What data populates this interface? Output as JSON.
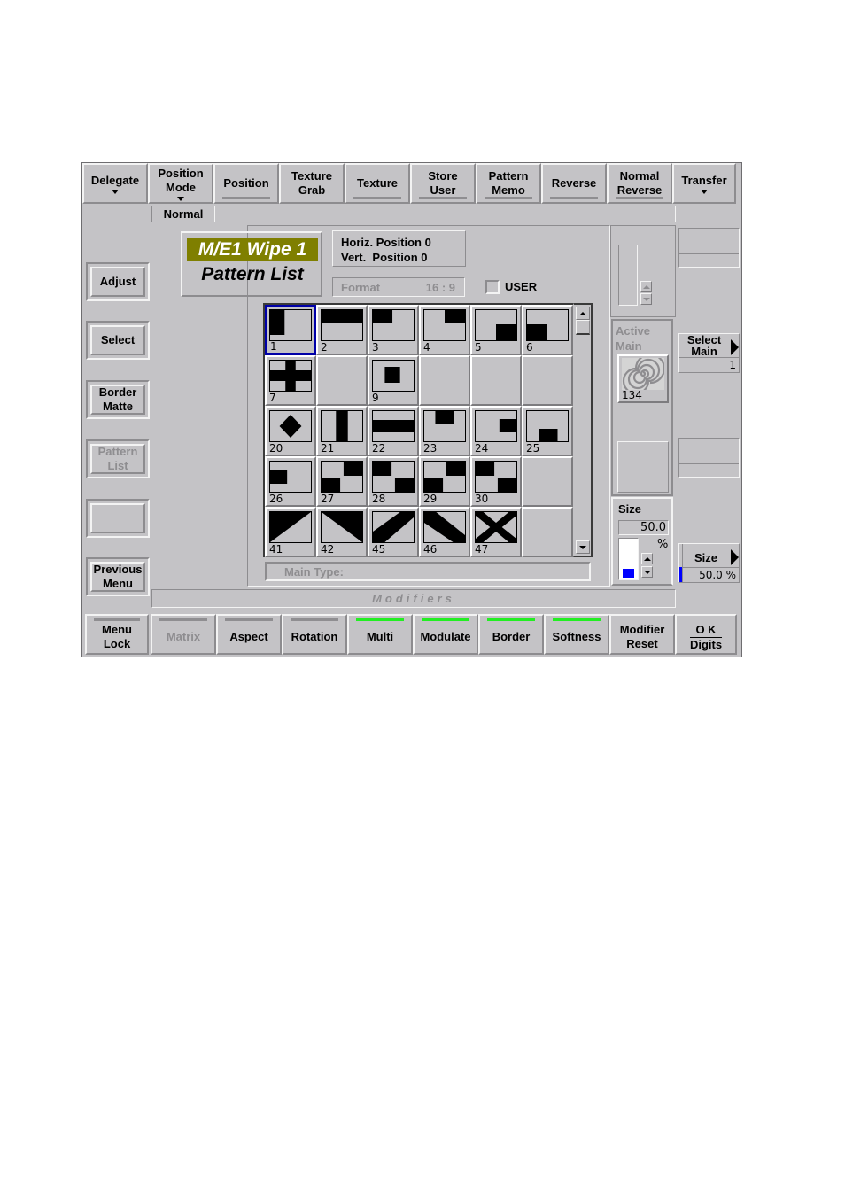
{
  "top_bar": [
    {
      "label_lines": [
        "Delegate"
      ],
      "dropdown": true,
      "underline": "none"
    },
    {
      "label_lines": [
        "Position",
        "Mode"
      ],
      "dropdown": true,
      "underline": "none"
    },
    {
      "label_lines": [
        "Position"
      ],
      "dropdown": false,
      "underline": "gray"
    },
    {
      "label_lines": [
        "Texture",
        "Grab"
      ],
      "dropdown": false,
      "underline": "none"
    },
    {
      "label_lines": [
        "Texture"
      ],
      "dropdown": false,
      "underline": "gray"
    },
    {
      "label_lines": [
        "Store",
        "User"
      ],
      "dropdown": false,
      "underline": "gray"
    },
    {
      "label_lines": [
        "Pattern",
        "Memo"
      ],
      "dropdown": false,
      "underline": "gray"
    },
    {
      "label_lines": [
        "Reverse"
      ],
      "dropdown": false,
      "underline": "gray"
    },
    {
      "label_lines": [
        "Normal",
        "Reverse"
      ],
      "dropdown": false,
      "underline": "gray"
    },
    {
      "label_lines": [
        "Transfer"
      ],
      "dropdown": true,
      "underline": "none"
    }
  ],
  "position_mode_value": "Normal",
  "title": {
    "line1": "M/E1 Wipe 1",
    "line2": "Pattern List"
  },
  "position_readout": {
    "horiz": "Horiz. Position 0",
    "vert": "Vert.  Position 0"
  },
  "format": {
    "label": "Format",
    "value": "16 : 9"
  },
  "user_checkbox": {
    "label": "USER",
    "checked": false
  },
  "left_menu": [
    {
      "label_lines": [
        "Adjust"
      ],
      "enabled": true
    },
    {
      "label_lines": [
        "Select"
      ],
      "enabled": true
    },
    {
      "label_lines": [
        "Border",
        "Matte"
      ],
      "enabled": true
    },
    {
      "label_lines": [
        "Pattern",
        "List"
      ],
      "enabled": false
    },
    {
      "label_lines": [],
      "enabled": true
    },
    {
      "label_lines": [
        "Previous",
        "Menu"
      ],
      "enabled": true
    }
  ],
  "patterns": [
    {
      "num": "1",
      "shape": "left-box",
      "selected": true
    },
    {
      "num": "2",
      "shape": "top-bar"
    },
    {
      "num": "3",
      "shape": "top-left-box"
    },
    {
      "num": "4",
      "shape": "top-right-box"
    },
    {
      "num": "5",
      "shape": "bottom-right-box"
    },
    {
      "num": "6",
      "shape": "bottom-left-box"
    },
    {
      "num": "7",
      "shape": "cross"
    },
    {
      "num": "",
      "shape": "empty"
    },
    {
      "num": "9",
      "shape": "center-box"
    },
    {
      "num": "",
      "shape": "empty"
    },
    {
      "num": "",
      "shape": "empty"
    },
    {
      "num": "",
      "shape": "empty"
    },
    {
      "num": "20",
      "shape": "diamond"
    },
    {
      "num": "21",
      "shape": "vertical-bar"
    },
    {
      "num": "22",
      "shape": "horizontal-bar"
    },
    {
      "num": "23",
      "shape": "top-center-box"
    },
    {
      "num": "24",
      "shape": "right-center-box"
    },
    {
      "num": "25",
      "shape": "bottom-center-box"
    },
    {
      "num": "26",
      "shape": "left-center-box"
    },
    {
      "num": "27",
      "shape": "checker-tr-bl"
    },
    {
      "num": "28",
      "shape": "checker-tl-br"
    },
    {
      "num": "29",
      "shape": "checker-tr-bl"
    },
    {
      "num": "30",
      "shape": "checker-tl-br"
    },
    {
      "num": "",
      "shape": "empty"
    },
    {
      "num": "41",
      "shape": "diag-tl"
    },
    {
      "num": "42",
      "shape": "diag-tr"
    },
    {
      "num": "45",
      "shape": "diag-band-up"
    },
    {
      "num": "46",
      "shape": "diag-band-down"
    },
    {
      "num": "47",
      "shape": "x-cross"
    },
    {
      "num": "",
      "shape": "empty"
    }
  ],
  "main_type": {
    "label": "Main Type:"
  },
  "modifiers_label": "Modifiers",
  "active_main": {
    "label_lines": [
      "Active",
      "Main"
    ],
    "pattern_num": "134",
    "icon": "spiral-icon"
  },
  "select_main": {
    "label_lines": [
      "Select",
      "Main"
    ],
    "value": "1"
  },
  "size_panel": {
    "label": "Size",
    "value": "50.0",
    "unit": "%",
    "level_percent": 50
  },
  "size_knob": {
    "label": "Size",
    "value": "50.0 %"
  },
  "bottom_bar": [
    {
      "label_lines": [
        "Menu",
        "Lock"
      ],
      "indicator": "gray",
      "enabled": true
    },
    {
      "label_lines": [
        "Matrix"
      ],
      "indicator": "gray",
      "enabled": false
    },
    {
      "label_lines": [
        "Aspect"
      ],
      "indicator": "gray",
      "enabled": true
    },
    {
      "label_lines": [
        "Rotation"
      ],
      "indicator": "gray",
      "enabled": true
    },
    {
      "label_lines": [
        "Multi"
      ],
      "indicator": "green",
      "enabled": true
    },
    {
      "label_lines": [
        "Modulate"
      ],
      "indicator": "green",
      "enabled": true
    },
    {
      "label_lines": [
        "Border"
      ],
      "indicator": "green",
      "enabled": true
    },
    {
      "label_lines": [
        "Softness"
      ],
      "indicator": "green",
      "enabled": true
    },
    {
      "label_lines": [
        "Modifier",
        "Reset"
      ],
      "indicator": "none",
      "enabled": true
    },
    {
      "label_lines": [
        "O K",
        "Digits"
      ],
      "indicator": "none",
      "enabled": true
    }
  ],
  "colors": {
    "panel_bg": "#c4c3c6",
    "title_highlight": "#7f7f00",
    "selection_border": "#0000a8",
    "active_indicator": "#22ee22",
    "level_fill": "#0000ff"
  }
}
